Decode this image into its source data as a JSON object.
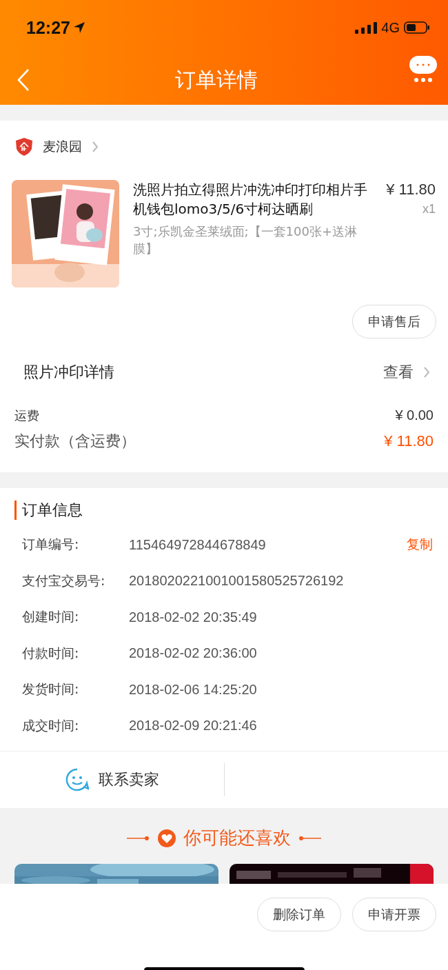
{
  "status_bar": {
    "time": "12:27",
    "network": "4G"
  },
  "nav": {
    "title": "订单详情"
  },
  "shop": {
    "name": "麦浪园"
  },
  "item": {
    "title": "洗照片拍立得照片冲洗冲印打印相片手机钱包lomo3/5/6寸柯达晒刷",
    "sku": "3寸;乐凯金圣莱绒面;【一套100张+送淋膜】",
    "price": "¥ 11.80",
    "quantity": "x1",
    "action": "申请售后"
  },
  "photo_details": {
    "label": "照片冲印详情",
    "link": "查看"
  },
  "totals": [
    {
      "label": "运费",
      "value": "¥ 0.00",
      "kind": "plain"
    },
    {
      "label": "实付款（含运费）",
      "value": "¥ 11.80",
      "kind": "highlight"
    }
  ],
  "order_info": {
    "title": "订单信息",
    "rows": [
      {
        "label": "订单编号:",
        "value": "115464972844678849",
        "action": "复制"
      },
      {
        "label": "支付宝交易号:",
        "value": "2018020221001001580525726192"
      },
      {
        "label": "创建时间:",
        "value": "2018-02-02 20:35:49"
      },
      {
        "label": "付款时间:",
        "value": "2018-02-02 20:36:00"
      },
      {
        "label": "发货时间:",
        "value": "2018-02-06 14:25:20"
      },
      {
        "label": "成交时间:",
        "value": "2018-02-09 20:21:46"
      }
    ]
  },
  "contact": {
    "label": "联系卖家"
  },
  "recommendations": {
    "title": "你可能还喜欢"
  },
  "bottom_actions": [
    "删除订单",
    "申请开票"
  ]
}
